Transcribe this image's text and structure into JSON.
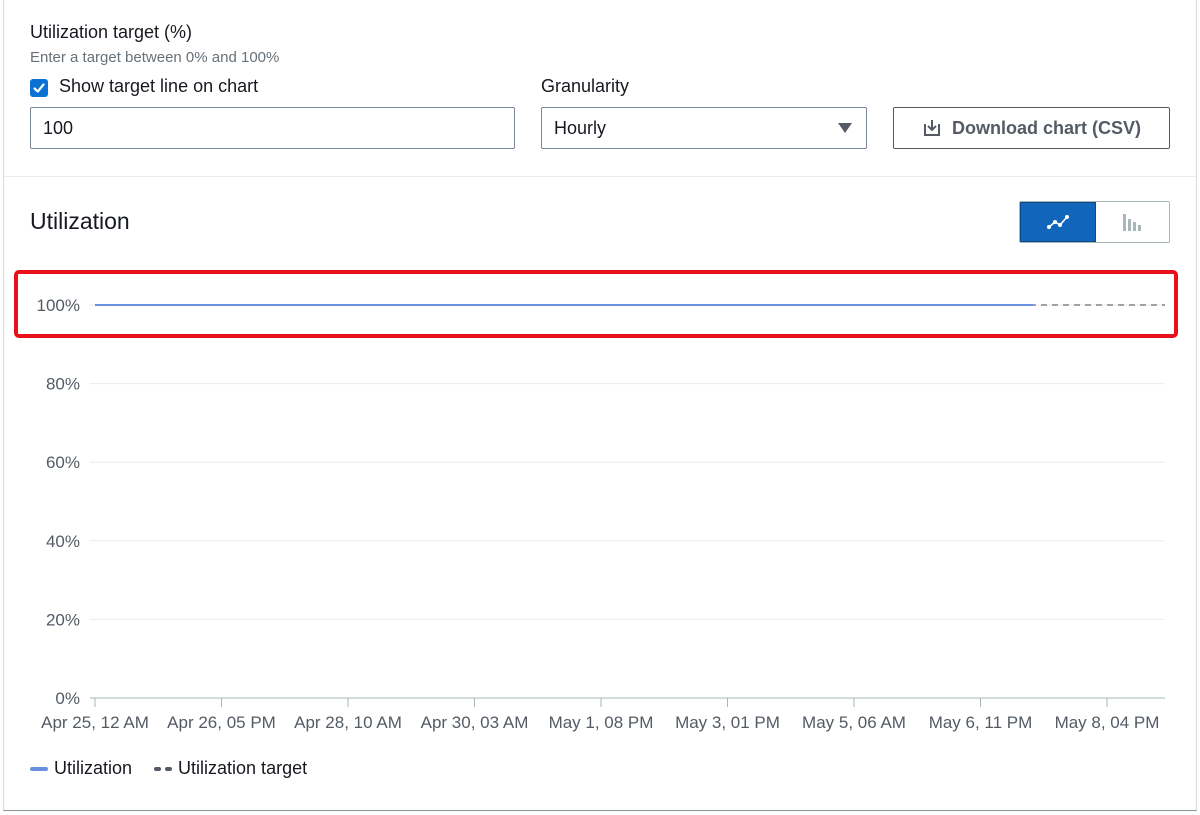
{
  "form": {
    "target_label": "Utilization target (%)",
    "target_hint": "Enter a target between 0% and 100%",
    "show_target_checked": true,
    "show_target_label": "Show target line on chart",
    "target_value": "100",
    "granularity_label": "Granularity",
    "granularity_value": "Hourly",
    "download_label": "Download chart (CSV)"
  },
  "section": {
    "title": "Utilization",
    "view_toggle": [
      "line-chart-icon",
      "bar-chart-icon"
    ],
    "active_view": "line"
  },
  "chart_data": {
    "type": "line",
    "title": "",
    "ylim": [
      0,
      100
    ],
    "yticks": [
      "0%",
      "20%",
      "40%",
      "60%",
      "80%",
      "100%"
    ],
    "x_ticks": [
      "Apr 25, 12 AM",
      "Apr 26, 05 PM",
      "Apr 28, 10 AM",
      "Apr 30, 03 AM",
      "May 1, 08 PM",
      "May 3, 01 PM",
      "May 5, 06 AM",
      "May 6, 11 PM",
      "May 8, 04 PM"
    ],
    "series": [
      {
        "name": "Utilization",
        "style": "solid",
        "color": "#6b8fe0",
        "x_start": "Apr 25, 12 AM",
        "x_end": "May 8, 12 AM",
        "value": 100
      },
      {
        "name": "Utilization target",
        "style": "dashed",
        "color": "#545b64",
        "x_start": "Apr 25, 12 AM",
        "x_end": "May 8, 11 PM",
        "value": 100
      }
    ],
    "grid": true,
    "legend": "bottom-left"
  },
  "colors": {
    "accent": "#0972d3",
    "highlight": "#e8101a"
  }
}
